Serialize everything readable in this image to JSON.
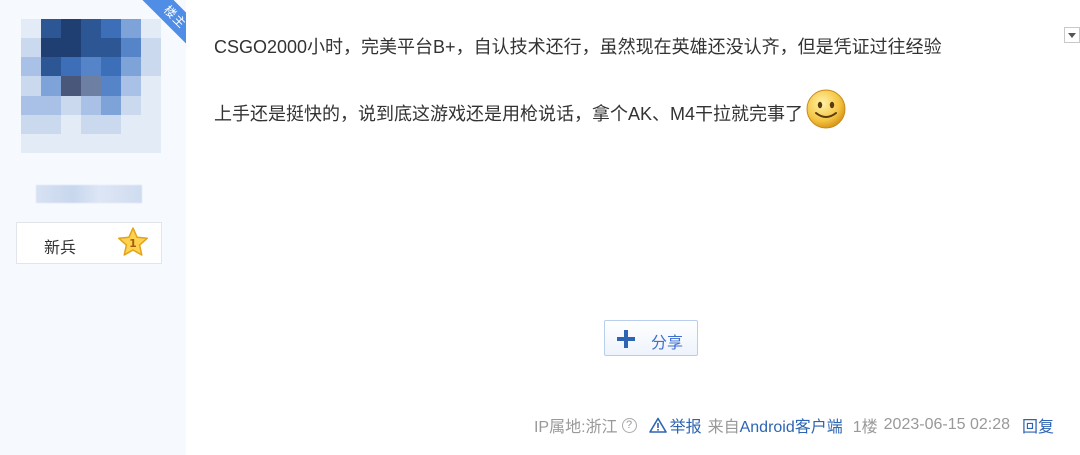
{
  "author": {
    "badge": "楼主",
    "level_name": "新兵",
    "level_number": "1"
  },
  "post": {
    "lines": [
      "CSGO2000小时，完美平台B+，自认技术还行，虽然现在英雄还没认齐，但是凭证过往经验",
      "上手还是挺快的，说到底这游戏还是用枪说话，拿个AK、M4干拉就完事了"
    ],
    "emoji": "smiley-icon"
  },
  "share": {
    "label": "分享"
  },
  "footer": {
    "ip_location": "IP属地:浙江",
    "help_mark": "?",
    "report_label": "举报",
    "from_prefix": "来自",
    "client": "Android客户端",
    "floor": "1楼",
    "timestamp": "2023-06-15 02:28",
    "reply_label": "回复"
  },
  "colors": {
    "sidebar_bg": "#f6f9fd",
    "badge_bg": "#4f8de6",
    "link": "#2d64b3",
    "share_text": "#3f6fd0",
    "muted": "#999999"
  }
}
